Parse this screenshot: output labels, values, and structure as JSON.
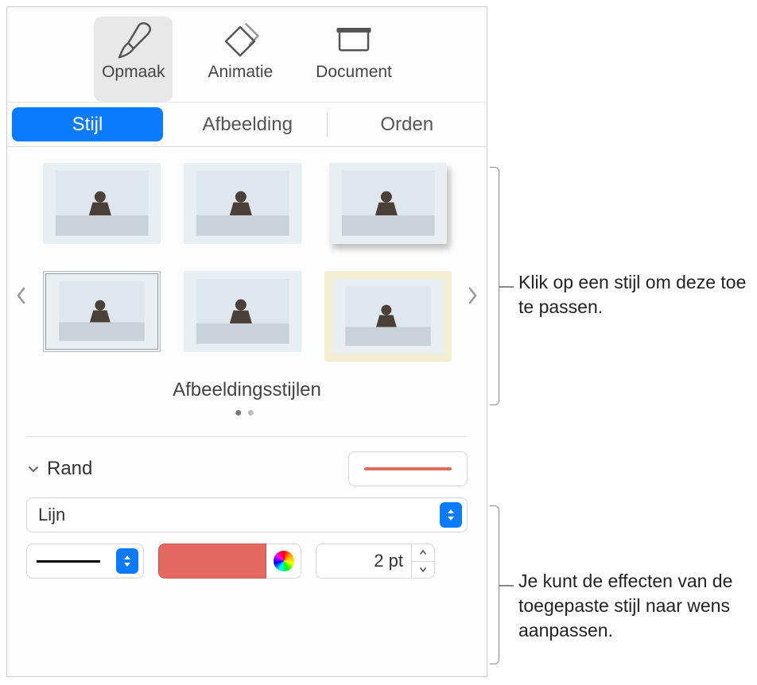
{
  "toolbar": {
    "format": "Opmaak",
    "animate": "Animatie",
    "document": "Document"
  },
  "tabs": {
    "style": "Stijl",
    "image": "Afbeelding",
    "arrange": "Orden"
  },
  "styles": {
    "caption": "Afbeeldingsstijlen"
  },
  "border": {
    "title": "Rand",
    "type": "Lijn",
    "size": "2 pt"
  },
  "annotations": {
    "a1": "Klik op een stijl om deze toe te passen.",
    "a2": "Je kunt de effecten van de toegepaste stijl naar wens aanpassen."
  },
  "colors": {
    "accent": "#0a7bff",
    "border_red": "#e46a61"
  }
}
